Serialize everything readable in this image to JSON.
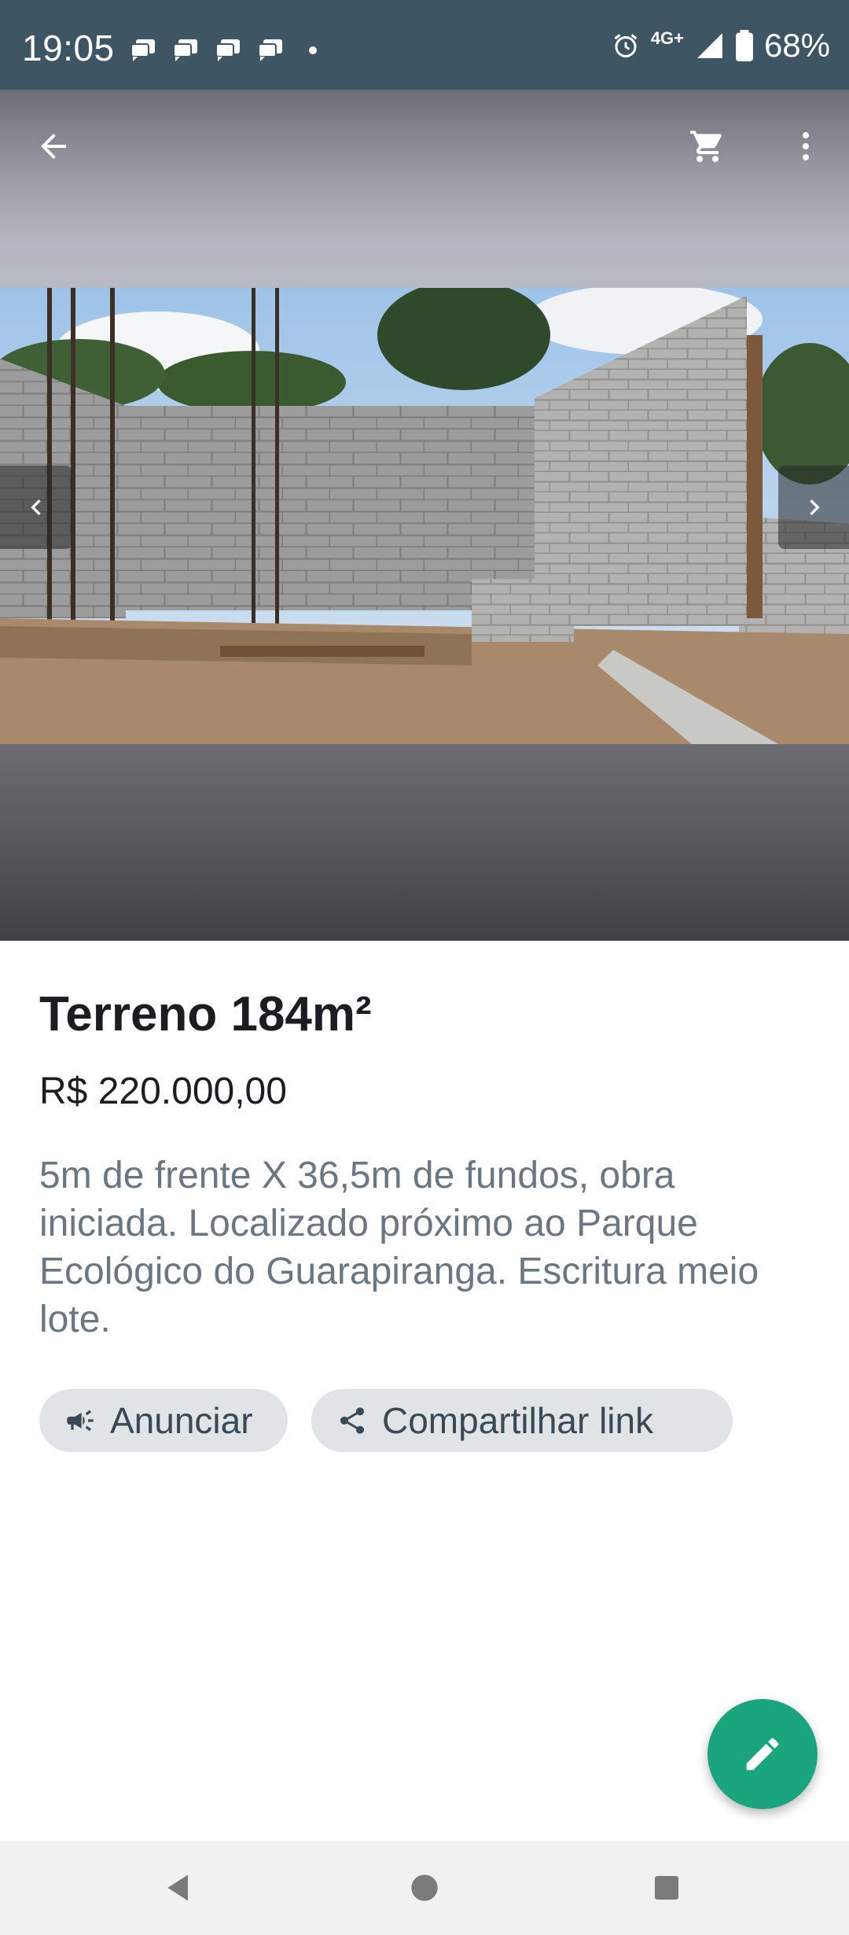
{
  "status_bar": {
    "time": "19:05",
    "network": "4G+",
    "battery": "68%",
    "icons": [
      "message-notification-icon",
      "message-notification-icon",
      "message-notification-icon",
      "message-notification-icon",
      "alarm-icon",
      "signal-icon",
      "battery-icon"
    ]
  },
  "toolbar": {
    "icons": [
      "back-arrow-icon",
      "shopping-cart-icon",
      "more-vert-icon"
    ]
  },
  "gallery": {
    "prev_icon": "chevron-left-icon",
    "next_icon": "chevron-right-icon"
  },
  "listing": {
    "title": "Terreno 184m²",
    "price": "R$ 220.000,00",
    "description": "5m de frente X 36,5m de fundos, obra iniciada. Localizado próximo ao Parque Ecológico do Guarapiranga. Escritura meio lote."
  },
  "actions": {
    "advertise_label": "Anunciar",
    "share_label": "Compartilhar link"
  },
  "fab": {
    "icon": "edit-pencil-icon"
  },
  "colors": {
    "status_bar": "#3e5563",
    "accent": "#1aa57e",
    "chip_bg": "#e1e4e7",
    "description_text": "#6a7682"
  }
}
